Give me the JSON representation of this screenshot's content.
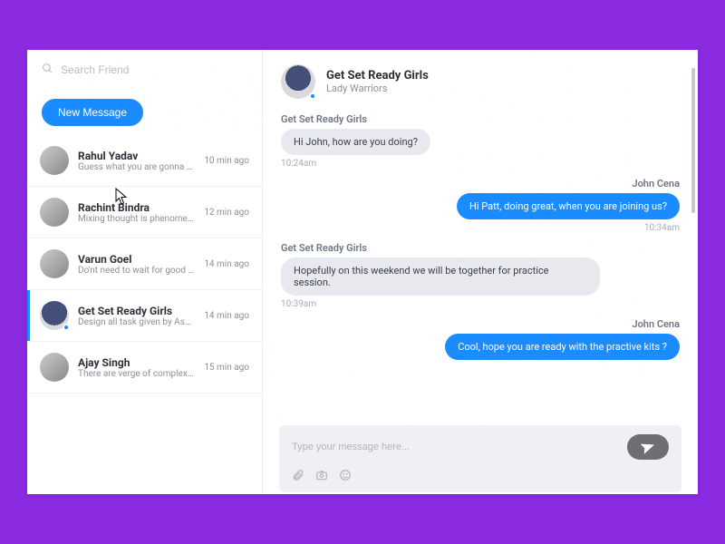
{
  "colors": {
    "accent": "#1a8cff",
    "outer": "#8a2be2"
  },
  "search": {
    "placeholder": "Search Friend"
  },
  "new_message_label": "New Message",
  "threads": [
    {
      "name": "Rahul Yadav",
      "preview": "Guess what you are gonna get with...",
      "time": "10 min ago",
      "active": false
    },
    {
      "name": "Rachint Bindra",
      "preview": "Mixing thought is phenomenal dis-...",
      "time": "12 min ago",
      "active": false
    },
    {
      "name": "Varun Goel",
      "preview": "Do'nt need to wait for good things t...",
      "time": "14 min ago",
      "active": false
    },
    {
      "name": "Get Set Ready Girls",
      "preview": "Design all task given by Ashwini on...",
      "time": "14 min ago",
      "active": true,
      "team": true
    },
    {
      "name": "Ajay Singh",
      "preview": "There are verge of complexity in m...",
      "time": "15 min ago",
      "active": false
    }
  ],
  "chat": {
    "title": "Get Set Ready Girls",
    "subtitle": "Lady Warriors",
    "self_name": "John Cena",
    "messages": [
      {
        "from": "them",
        "sender": "Get Set Ready Girls",
        "text": "Hi John, how are you doing?",
        "time": "10:24am"
      },
      {
        "from": "me",
        "sender": "John Cena",
        "text": "Hi Patt, doing great, when you are joining us?",
        "time": "10:34am"
      },
      {
        "from": "them",
        "sender": "Get Set Ready Girls",
        "text": "Hopefully on this weekend we will be together for practice session.",
        "time": "10:39am"
      },
      {
        "from": "me",
        "sender": "John Cena",
        "text": "Cool, hope you are ready with the practive kits ?",
        "time": ""
      }
    ],
    "composer_placeholder": "Type your message here..."
  }
}
